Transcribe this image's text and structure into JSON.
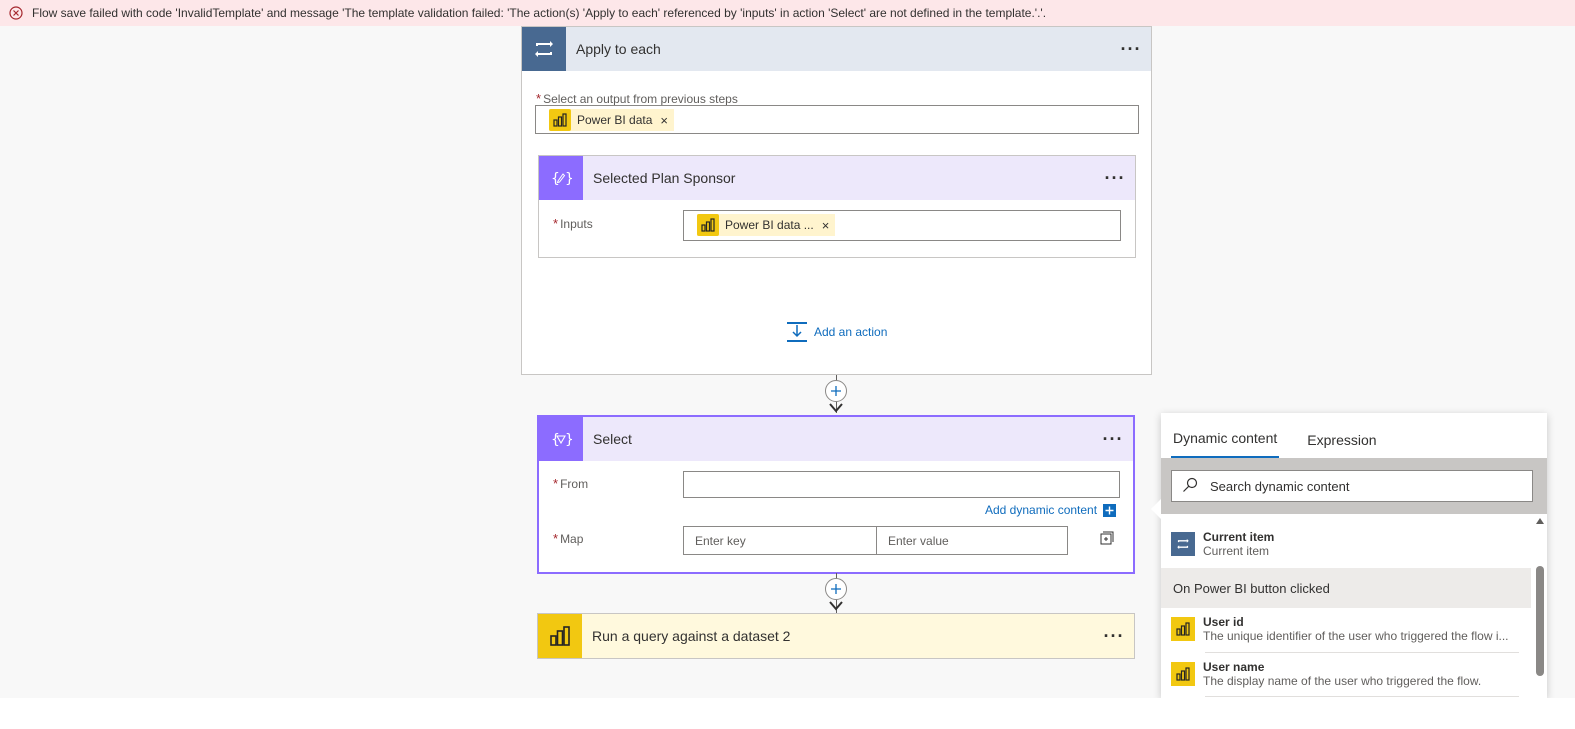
{
  "error_banner": {
    "message": "Flow save failed with code 'InvalidTemplate' and message 'The template validation failed: 'The action(s) 'Apply to each' referenced by 'inputs' in action 'Select' are not defined in the template.'.'."
  },
  "apply_to_each": {
    "title": "Apply to each",
    "menu": "···",
    "output_label": "Select an output from previous steps",
    "output_token": "Power BI data",
    "token_remove": "×",
    "inner_action": {
      "title": "Selected Plan Sponsor",
      "menu": "···",
      "inputs_label": "Inputs",
      "inputs_token": "Power BI data ...",
      "token_remove": "×"
    },
    "add_action_label": "Add an action"
  },
  "select_action": {
    "title": "Select",
    "menu": "···",
    "from_label": "From",
    "from_value": "",
    "add_dynamic_label": "Add dynamic content",
    "map_label": "Map",
    "key_placeholder": "Enter key",
    "value_placeholder": "Enter value"
  },
  "query_action": {
    "title": "Run a query against a dataset 2",
    "menu": "···"
  },
  "dynamic_panel": {
    "tabs": [
      "Dynamic content",
      "Expression"
    ],
    "search_placeholder": "Search dynamic content",
    "items_top": [
      {
        "name": "Current item",
        "desc": "Current item"
      }
    ],
    "section_title": "On Power BI button clicked",
    "items_section": [
      {
        "name": "User id",
        "desc": "The unique identifier of the user who triggered the flow i..."
      },
      {
        "name": "User name",
        "desc": "The display name of the user who triggered the flow."
      }
    ]
  },
  "colors": {
    "apply_header": "#e3e8f0",
    "apply_icon": "#486991",
    "select_header": "#ede8fb",
    "select_icon": "#8c6cff",
    "query_header": "#fff9dd",
    "pbi_yellow": "#f2c811",
    "error_bg": "#fde7e9",
    "link": "#0f6cbd"
  }
}
